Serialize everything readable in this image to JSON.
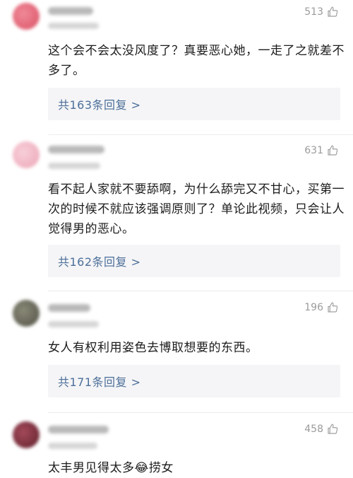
{
  "comments": [
    {
      "likes": "513",
      "text": "这个会不会太没风度了？真要恶心她，一走了之就差不多了。",
      "replies": "共163条回复 >",
      "avatar_color": "#e36a7a"
    },
    {
      "likes": "631",
      "text": "看不起人家就不要舔啊，为什么舔完又不甘心，买第一次的时候不就应该强调原则了？单论此视频，只会让人觉得男的恶心。",
      "replies": "共162条回复 >",
      "avatar_color": "#f0b7c4"
    },
    {
      "likes": "196",
      "text": "女人有权利用姿色去博取想要的东西。",
      "replies": "共171条回复 >",
      "avatar_color": "#6b6a5c"
    },
    {
      "likes": "458",
      "text": "太丰男见得太多😂捞女",
      "avatar_color": "#7a2d3c"
    }
  ],
  "colors": {
    "reply_link": "#4c6f99",
    "meta": "#9b9b9b",
    "reply_bg": "#f5f5f7"
  },
  "icons": {
    "like": "thumbs-up-icon"
  }
}
